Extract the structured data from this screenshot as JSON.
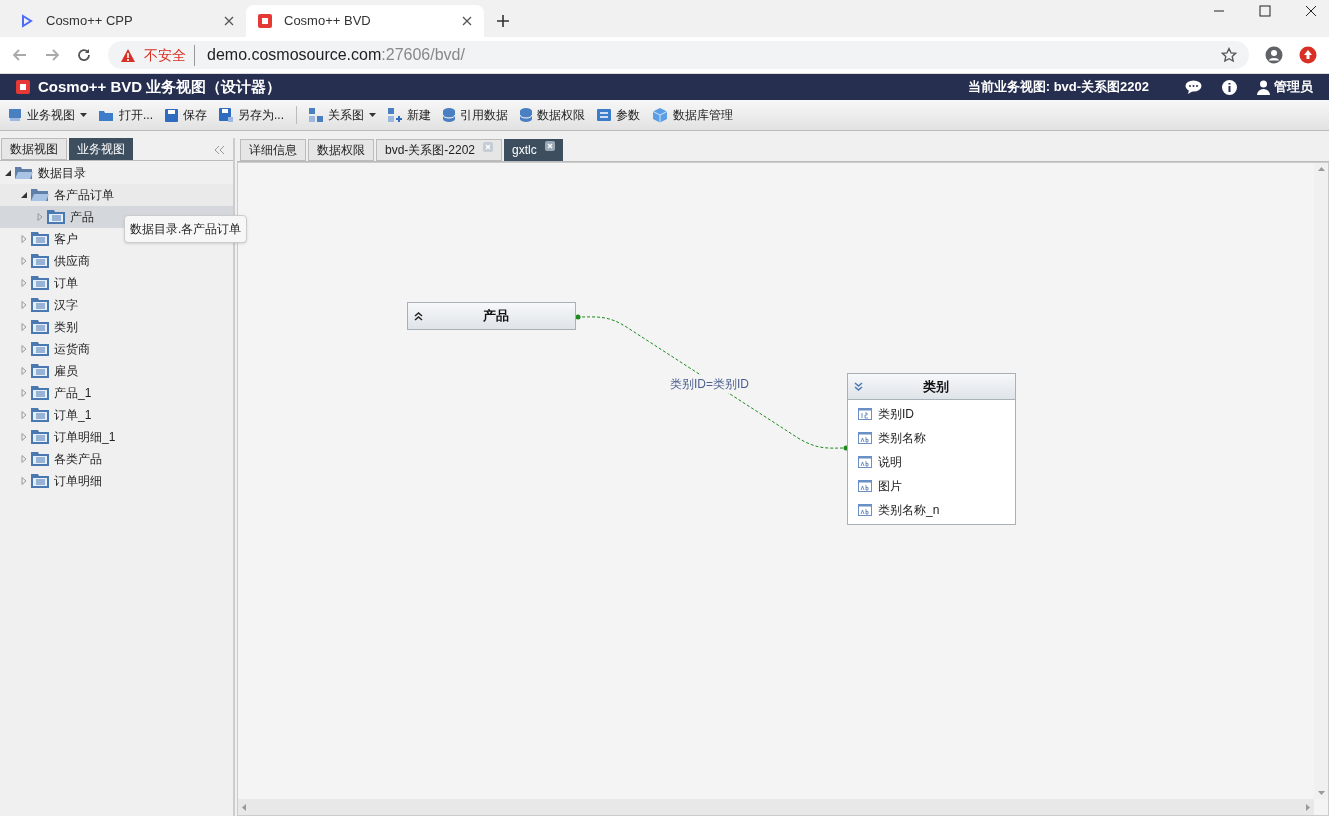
{
  "browser": {
    "tabs": [
      {
        "title": "Cosmo++ CPP",
        "selected": false
      },
      {
        "title": "Cosmo++ BVD",
        "selected": true
      }
    ],
    "address": {
      "warning": "不安全",
      "host": "demo.cosmosource.com",
      "rest": ":27606/bvd/"
    }
  },
  "app_header": {
    "title": "Cosmo++ BVD 业务视图（设计器）",
    "current_view": "当前业务视图: bvd-关系图2202",
    "user": "管理员"
  },
  "toolbar": [
    {
      "label": "业务视图",
      "dropdown": true
    },
    {
      "label": "打开..."
    },
    {
      "label": "保存"
    },
    {
      "label": "另存为..."
    },
    {
      "label": "关系图",
      "dropdown": true,
      "separator_before": true
    },
    {
      "label": "新建"
    },
    {
      "label": "引用数据"
    },
    {
      "label": "数据权限"
    },
    {
      "label": "参数"
    },
    {
      "label": "数据库管理"
    }
  ],
  "left_panel": {
    "tabs": [
      {
        "label": "数据视图",
        "selected": false
      },
      {
        "label": "业务视图",
        "selected": true
      }
    ],
    "tree": [
      {
        "label": "数据目录",
        "kind": "folder",
        "expanded": true,
        "selected": false,
        "children": [
          {
            "label": "各产品订单",
            "kind": "folder",
            "expanded": true,
            "selected": false,
            "children": [
              {
                "label": "产品",
                "kind": "table",
                "expanded": false,
                "selected": true
              }
            ]
          },
          {
            "label": "客户",
            "kind": "table",
            "expanded": false,
            "selected": false
          },
          {
            "label": "供应商",
            "kind": "table",
            "expanded": false,
            "selected": false
          },
          {
            "label": "订单",
            "kind": "table",
            "expanded": false,
            "selected": false
          },
          {
            "label": "汉字",
            "kind": "table",
            "expanded": false,
            "selected": false
          },
          {
            "label": "类别",
            "kind": "table",
            "expanded": false,
            "selected": false
          },
          {
            "label": "运货商",
            "kind": "table",
            "expanded": false,
            "selected": false
          },
          {
            "label": "雇员",
            "kind": "table",
            "expanded": false,
            "selected": false
          },
          {
            "label": "产品_1",
            "kind": "table",
            "expanded": false,
            "selected": false
          },
          {
            "label": "订单_1",
            "kind": "table",
            "expanded": false,
            "selected": false
          },
          {
            "label": "订单明细_1",
            "kind": "table",
            "expanded": false,
            "selected": false
          },
          {
            "label": "各类产品",
            "kind": "table",
            "expanded": false,
            "selected": false
          },
          {
            "label": "订单明细",
            "kind": "table",
            "expanded": false,
            "selected": false
          }
        ]
      }
    ],
    "tooltip": "数据目录.各产品订单"
  },
  "content_tabs": [
    {
      "label": "详细信息",
      "selected": false,
      "closable": false
    },
    {
      "label": "数据权限",
      "selected": false,
      "closable": false
    },
    {
      "label": "bvd-关系图-2202",
      "selected": false,
      "closable": true
    },
    {
      "label": "gxtlc",
      "selected": true,
      "closable": true
    }
  ],
  "diagram": {
    "entities": [
      {
        "title": "产品",
        "expanded": false
      },
      {
        "title": "类别",
        "expanded": true,
        "fields": [
          {
            "name": "类别ID",
            "kind": "number"
          },
          {
            "name": "类别名称",
            "kind": "text"
          },
          {
            "name": "说明",
            "kind": "text"
          },
          {
            "name": "图片",
            "kind": "text"
          },
          {
            "name": "类别名称_n",
            "kind": "text"
          }
        ]
      }
    ],
    "relation": {
      "label": "类别ID=类别ID"
    }
  }
}
